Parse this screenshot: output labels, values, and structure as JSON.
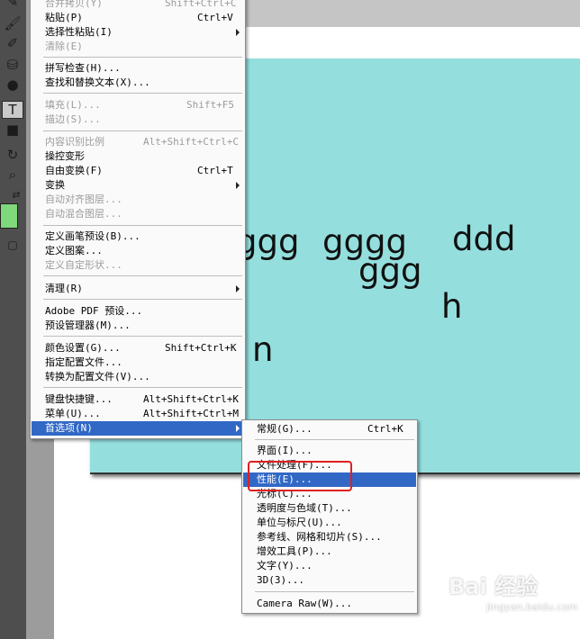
{
  "colors": {
    "canvas": "#95dede",
    "selection": "#3168c6",
    "foreground_swatch": "#7fd87a",
    "highlight": "#e02020"
  },
  "toolbar": {
    "tools": [
      "brush-icon",
      "mixer-brush-icon",
      "paint-bucket-icon",
      "dodge-icon",
      "type-icon",
      "rectangle-icon",
      "path-select-icon",
      "zoom-icon",
      "swap-colors-icon"
    ],
    "type_tool_glyph": "T"
  },
  "canvas_text": [
    "ggg",
    "gggg",
    "ddd",
    "ggg",
    "h",
    "n"
  ],
  "edit_menu": {
    "items": [
      {
        "label": "合并拷贝(Y)",
        "shortcut": "Shift+Ctrl+C",
        "disabled": true
      },
      {
        "label": "粘贴(P)",
        "shortcut": "Ctrl+V"
      },
      {
        "label": "选择性粘贴(I)",
        "submenu": true
      },
      {
        "label": "清除(E)",
        "disabled": true
      },
      {
        "label": "拼写检查(H)..."
      },
      {
        "label": "查找和替换文本(X)..."
      },
      {
        "label": "填充(L)...",
        "shortcut": "Shift+F5",
        "disabled": true
      },
      {
        "label": "描边(S)...",
        "disabled": true
      },
      {
        "label": "内容识别比例",
        "shortcut": "Alt+Shift+Ctrl+C",
        "disabled": true
      },
      {
        "label": "操控变形"
      },
      {
        "label": "自由变换(F)",
        "shortcut": "Ctrl+T"
      },
      {
        "label": "变换",
        "submenu": true
      },
      {
        "label": "自动对齐图层...",
        "disabled": true
      },
      {
        "label": "自动混合图层...",
        "disabled": true
      },
      {
        "label": "定义画笔预设(B)..."
      },
      {
        "label": "定义图案..."
      },
      {
        "label": "定义自定形状...",
        "disabled": true
      },
      {
        "label": "清理(R)",
        "submenu": true
      },
      {
        "label": "Adobe PDF 预设..."
      },
      {
        "label": "预设管理器(M)..."
      },
      {
        "label": "颜色设置(G)...",
        "shortcut": "Shift+Ctrl+K"
      },
      {
        "label": "指定配置文件..."
      },
      {
        "label": "转换为配置文件(V)..."
      },
      {
        "label": "键盘快捷键...",
        "shortcut": "Alt+Shift+Ctrl+K"
      },
      {
        "label": "菜单(U)...",
        "shortcut": "Alt+Shift+Ctrl+M"
      },
      {
        "label": "首选项(N)",
        "submenu": true,
        "selected": true
      }
    ]
  },
  "prefs_menu": {
    "items": [
      {
        "label": "常规(G)...",
        "shortcut": "Ctrl+K"
      },
      {
        "label": "界面(I)..."
      },
      {
        "label": "文件处理(F)..."
      },
      {
        "label": "性能(E)...",
        "selected": true
      },
      {
        "label": "光标(C)..."
      },
      {
        "label": "透明度与色域(T)..."
      },
      {
        "label": "单位与标尺(U)..."
      },
      {
        "label": "参考线、网格和切片(S)..."
      },
      {
        "label": "增效工具(P)..."
      },
      {
        "label": "文字(Y)..."
      },
      {
        "label": "3D(3)..."
      },
      {
        "label": "Camera Raw(W)..."
      }
    ]
  },
  "watermark": {
    "brand": "Bai 经验",
    "url": "jingyan.baidu.com"
  }
}
